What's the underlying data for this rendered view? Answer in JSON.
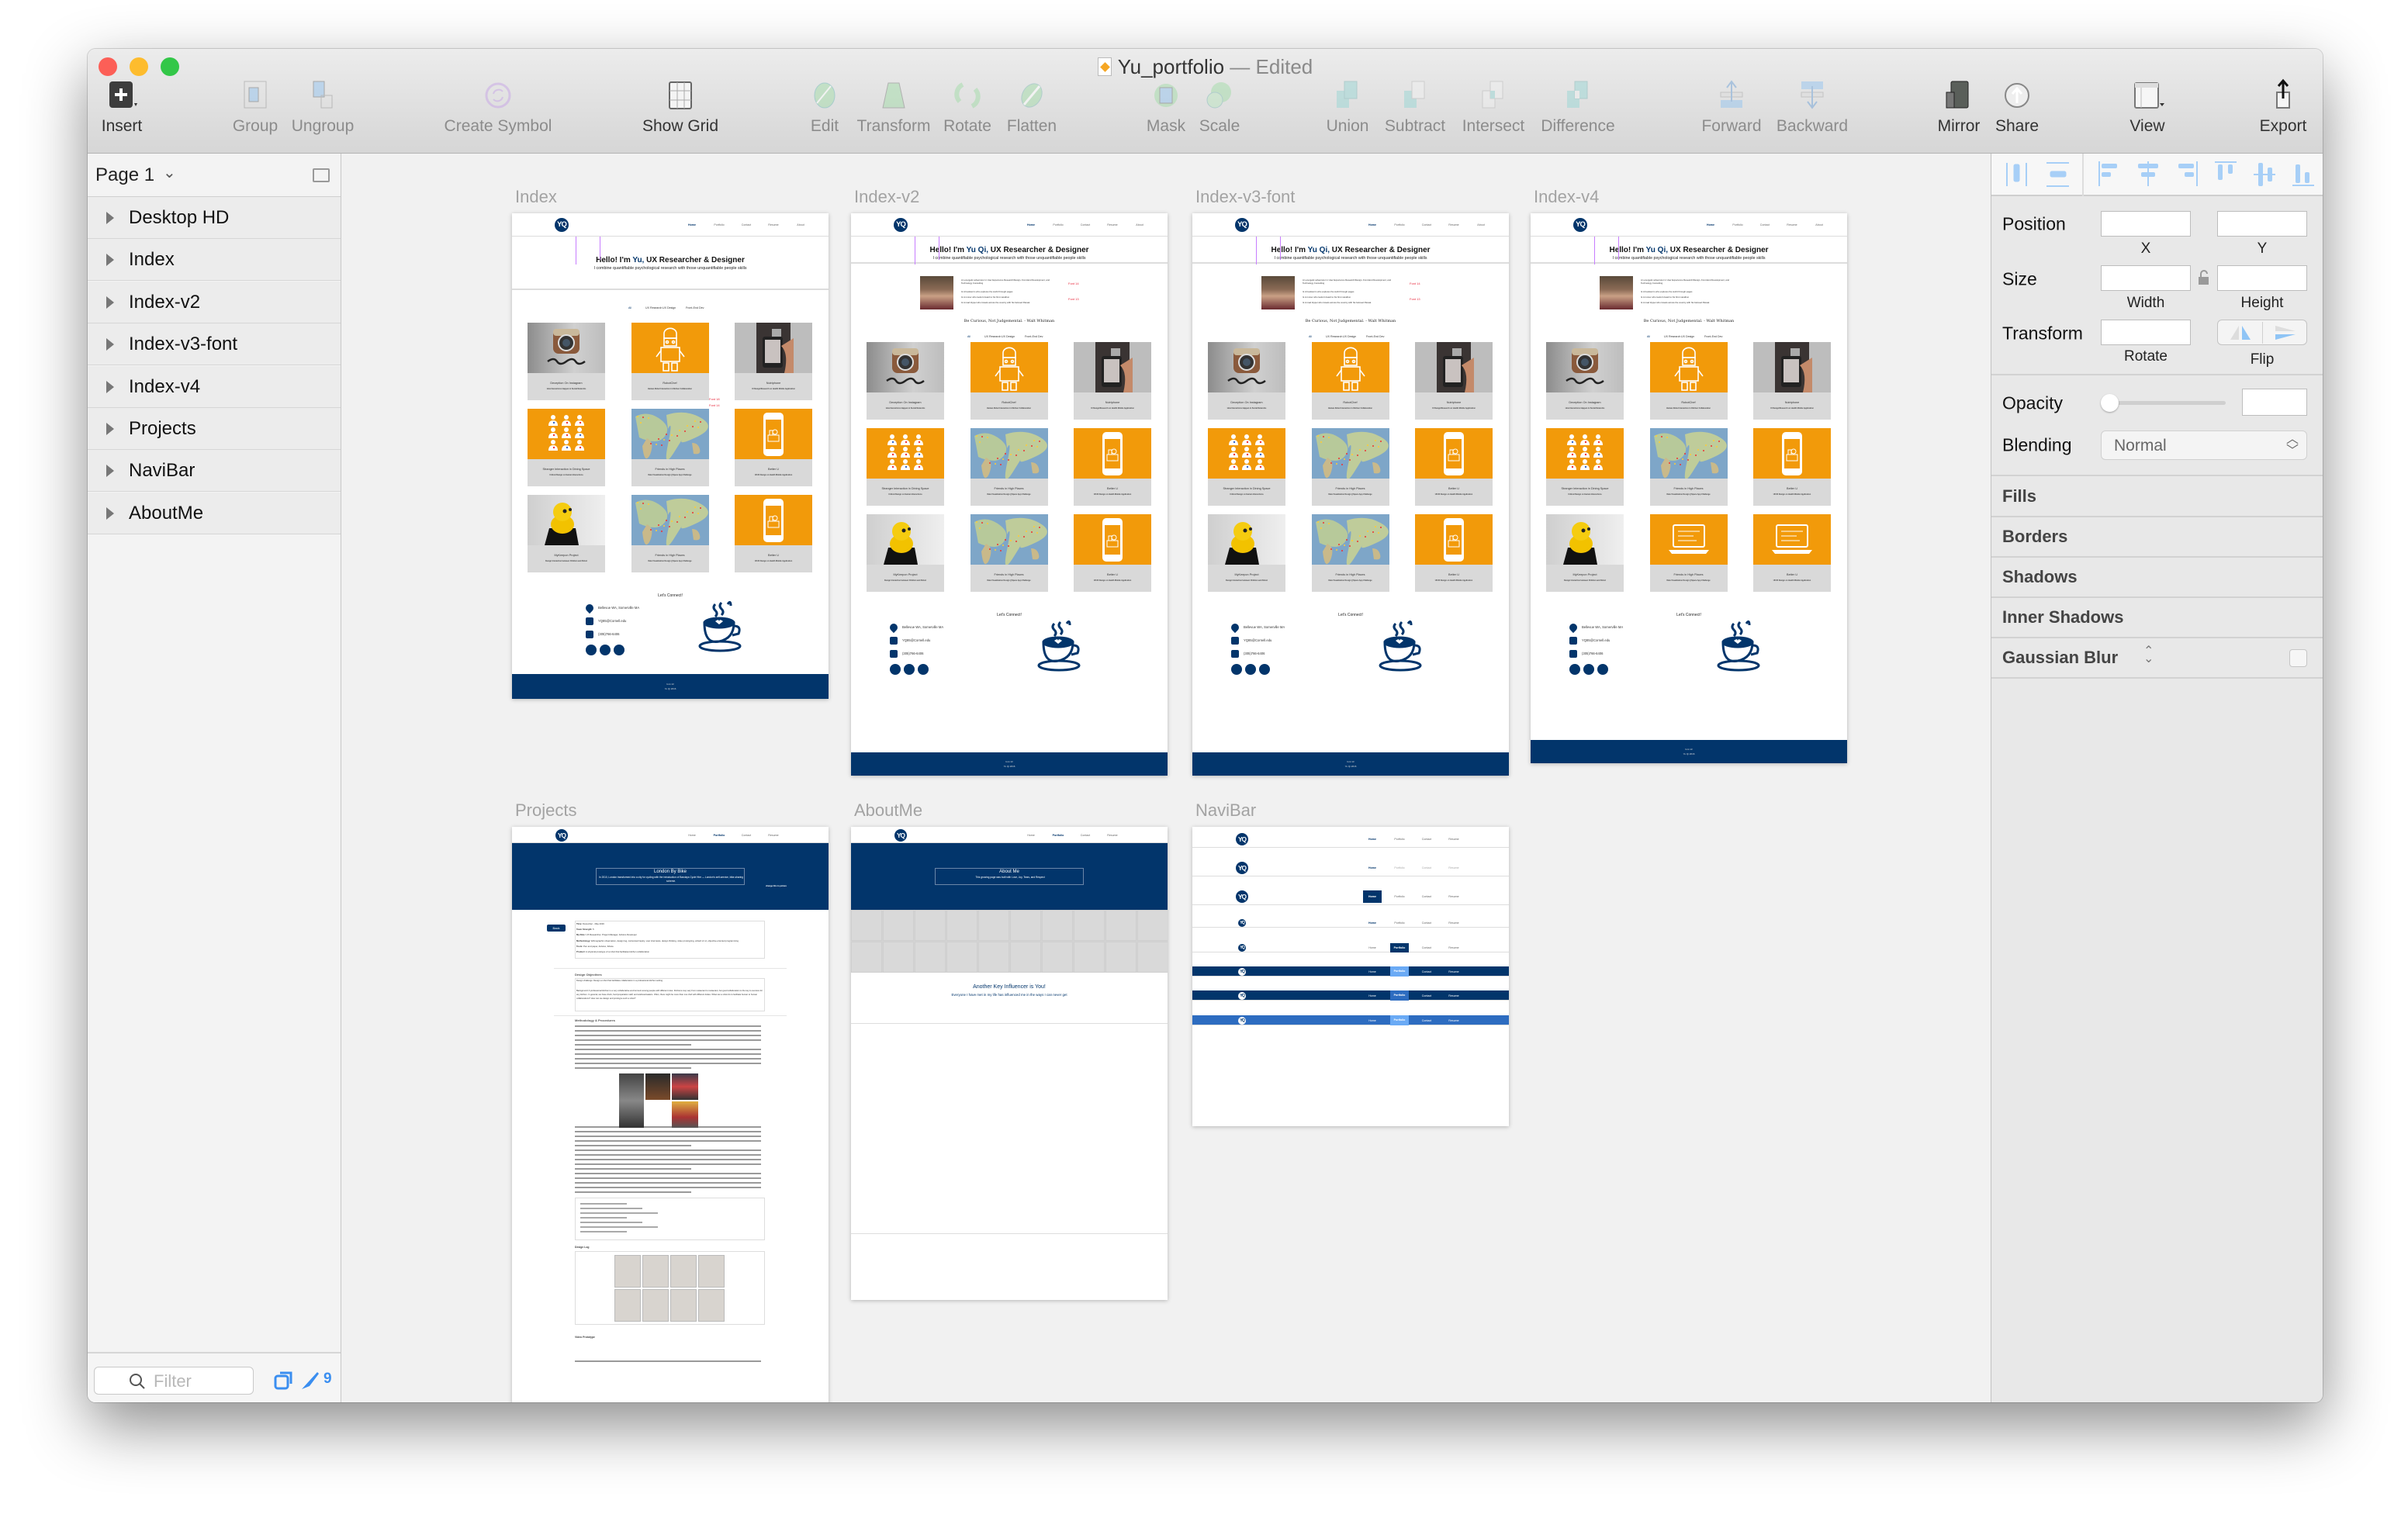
{
  "window": {
    "title": "Yu_portfolio",
    "title_status": "— Edited",
    "traffic_lights": {
      "close": "#fc5f57",
      "minimize": "#fdbc2e",
      "zoom": "#33c748"
    }
  },
  "toolbar": {
    "items": [
      {
        "label": "Insert",
        "icon": "insert-plus-icon",
        "enabled": true
      },
      {
        "label": "Group",
        "icon": "group-icon",
        "enabled": false
      },
      {
        "label": "Ungroup",
        "icon": "ungroup-icon",
        "enabled": false
      },
      {
        "label": "Create Symbol",
        "icon": "create-symbol-icon",
        "enabled": false
      },
      {
        "label": "Show Grid",
        "icon": "grid-icon",
        "enabled": true
      },
      {
        "label": "Edit",
        "icon": "edit-vector-icon",
        "enabled": false
      },
      {
        "label": "Transform",
        "icon": "transform-icon",
        "enabled": false
      },
      {
        "label": "Rotate",
        "icon": "rotate-icon",
        "enabled": false
      },
      {
        "label": "Flatten",
        "icon": "flatten-icon",
        "enabled": false
      },
      {
        "label": "Mask",
        "icon": "mask-icon",
        "enabled": false
      },
      {
        "label": "Scale",
        "icon": "scale-icon",
        "enabled": false
      },
      {
        "label": "Union",
        "icon": "union-icon",
        "enabled": false
      },
      {
        "label": "Subtract",
        "icon": "subtract-icon",
        "enabled": false
      },
      {
        "label": "Intersect",
        "icon": "intersect-icon",
        "enabled": false
      },
      {
        "label": "Difference",
        "icon": "difference-icon",
        "enabled": false
      },
      {
        "label": "Forward",
        "icon": "forward-icon",
        "enabled": false
      },
      {
        "label": "Backward",
        "icon": "backward-icon",
        "enabled": false
      },
      {
        "label": "Mirror",
        "icon": "mirror-icon",
        "enabled": true
      },
      {
        "label": "Share",
        "icon": "share-icon",
        "enabled": true
      },
      {
        "label": "View",
        "icon": "view-icon",
        "enabled": true
      },
      {
        "label": "Export",
        "icon": "export-icon",
        "enabled": true
      }
    ]
  },
  "sidebar": {
    "page_selector": "Page 1",
    "layers": [
      "Desktop HD",
      "Index",
      "Index-v2",
      "Index-v3-font",
      "Index-v4",
      "Projects",
      "NaviBar",
      "AboutMe"
    ],
    "filter_placeholder": "Filter",
    "artboard_count": "9"
  },
  "inspector": {
    "position_label": "Position",
    "x_label": "X",
    "y_label": "Y",
    "size_label": "Size",
    "width_label": "Width",
    "height_label": "Height",
    "transform_label": "Transform",
    "rotate_label": "Rotate",
    "flip_label": "Flip",
    "opacity_label": "Opacity",
    "opacity_value": 0,
    "blending_label": "Blending",
    "blending_value": "Normal",
    "sections": [
      "Fills",
      "Borders",
      "Shadows",
      "Inner Shadows",
      "Gaussian Blur"
    ]
  },
  "colors": {
    "navy": "#02356b",
    "orange": "#f29a0a",
    "accent_blue": "#2d6cc0",
    "light_blue": "#6aaaf5",
    "annotation_red": "#e8283c",
    "annotation_purple": "#c77dff"
  },
  "site": {
    "nav": [
      "Home",
      "Portfolio",
      "Contact",
      "Resume",
      "About"
    ],
    "logo": "YQ",
    "filters": [
      "All",
      "UX Research",
      "UX Design",
      "Front-End Dev"
    ],
    "cards": [
      {
        "title": "Deception On Instagram",
        "subtitle": "How Interactions Happen in Social Networks",
        "kind": "instagram"
      },
      {
        "title": "RobotChef",
        "subtitle": "Human-Robot Interaction in Kitchen Collaboration",
        "kind": "robot"
      },
      {
        "title": "Nutriphone",
        "subtitle": "UI Design/Research on Health Mobile Application",
        "kind": "phone-photo"
      },
      {
        "title": "Stranger Interaction in Dining Space",
        "subtitle": "Critical Design on Human Interactions",
        "kind": "people"
      },
      {
        "title": "Friends in High Places",
        "subtitle": "Data Visualization Design || Space App Challenge",
        "kind": "map"
      },
      {
        "title": "Better U",
        "subtitle": "UI/UX Design on Health Mobile Application",
        "kind": "app"
      },
      {
        "title": "MyKeepon Project",
        "subtitle": "Design Interaction between Children and Robot",
        "kind": "keepon"
      },
      {
        "title": "Friends in High Places",
        "subtitle": "Data Visualization Design || Space App Challenge",
        "kind": "map"
      },
      {
        "title": "Better U",
        "subtitle": "UI/UX Design on Health Mobile Application",
        "kind": "app"
      }
    ],
    "cards_v4_row3": [
      {
        "title": "MyKeepon Project",
        "subtitle": "Design Interaction between Children and Robot",
        "kind": "keepon"
      },
      {
        "title": "Friends in High Places",
        "subtitle": "Data Visualization Design || Space App Challenge",
        "kind": "laptop"
      },
      {
        "title": "Better U",
        "subtitle": "UI/UX Design on Health Mobile Application",
        "kind": "laptop"
      }
    ],
    "hero_prefix": "Hello! I'm ",
    "hero_suffix": " UX Researcher & Designer",
    "hero_subtitle": "I combine quantifiable psychological research with those unquantifiable people skills",
    "intro": [
      "An energetic adventurer in User Experience Research/Design, Front-End Development, and Technology Consulting",
      "A bookworm who explores the world through pages",
      "A runner who looks forward to his first marathon",
      "A road tripper who travels across the country with his beloved Passat"
    ],
    "quote": "Be Curious, Not Judgemental. - Walt Whitman",
    "connect_title": "Let's Connect!",
    "contact": [
      "Bellevue WA, Somerville MA",
      "YQ85@Cornell.edu",
      "(305)766-6406"
    ],
    "footer": [
      "font 13",
      "Yu Qi 2016"
    ]
  },
  "artboards": [
    {
      "name": "Index",
      "type": "home",
      "hero_name": "Yu,",
      "intro": false,
      "annotations": [
        "Font 18",
        "Font 14"
      ]
    },
    {
      "name": "Index-v2",
      "type": "home",
      "hero_name": "Yu Qi,",
      "intro": true,
      "annotations": [
        "Font 14",
        "Font 13"
      ]
    },
    {
      "name": "Index-v3-font",
      "type": "home",
      "hero_name": "Yu Qi,",
      "intro": true,
      "annotations": [
        "Font 14",
        "Font 13"
      ]
    },
    {
      "name": "Index-v4",
      "type": "home",
      "hero_name": "Yu Qi,",
      "intro": true,
      "v4": true,
      "annotations": []
    },
    {
      "name": "Projects",
      "type": "project",
      "hero_title": "London By Bike",
      "hero_text": "In 2010, London transformed into a city for cycling with the introduction of Barclays Cycle Hire — London's self-service, bike-sharing scheme.",
      "note": "change this to picture",
      "back": "Back",
      "info": [
        {
          "k": "Time:",
          "v": "December - May 2016"
        },
        {
          "k": "Team Strength:",
          "v": "5"
        },
        {
          "k": "My Role:",
          "v": "UX Researcher, Project Manager, Arduino Developer"
        },
        {
          "k": "Methodology:",
          "v": "Ethnographic observation, design log, contextual inquiry, user interviews, design thinking, video prototyping, wizard of oz, objective-oriented programming"
        },
        {
          "k": "Tools:",
          "v": "Pen and paper, Arduino, iMovie"
        },
        {
          "k": "Product:",
          "v": "A physical prototype of a robot that facilitates kitchen collaboration"
        }
      ],
      "objectives_title": "Design Objectives",
      "objectives": [
        "Design challenge: Design a robot that facilitates collaboration in a professional kitchen setting.",
        "Background: A professional kitchen is a very collaborative environment among people with different roles. Kitchens may vary from restaurant to restaurant, but good collaboration is the key to success for any kitchen. In general, we have chefs, food preparation staff, and waitress/waiters. Often, there might be more than one chef with different duties. What can a robot do to facilitate human to human collaborations? How can we design and prototype such a robot?"
      ],
      "methodology_title": "Methodology & Procedures",
      "design_log_title": "Design Log",
      "video_title": "Video Prototype"
    },
    {
      "name": "AboutMe",
      "type": "about",
      "hero_title": "About Me",
      "hero_text": "This growing page was built with Love, Joy, Tears, and Respect",
      "influencer_title": "Another Key Influencer is You!",
      "influencer_text": "Everyone I have met in my life has influenced me in the ways I can never get"
    },
    {
      "name": "NaviBar",
      "type": "navibar",
      "variants": [
        "plain-home",
        "plain-home-light",
        "boxed-home",
        "small-home",
        "boxed-portfolio",
        "navy-lightblue",
        "navy-blue",
        "blue-lightblue"
      ]
    }
  ]
}
